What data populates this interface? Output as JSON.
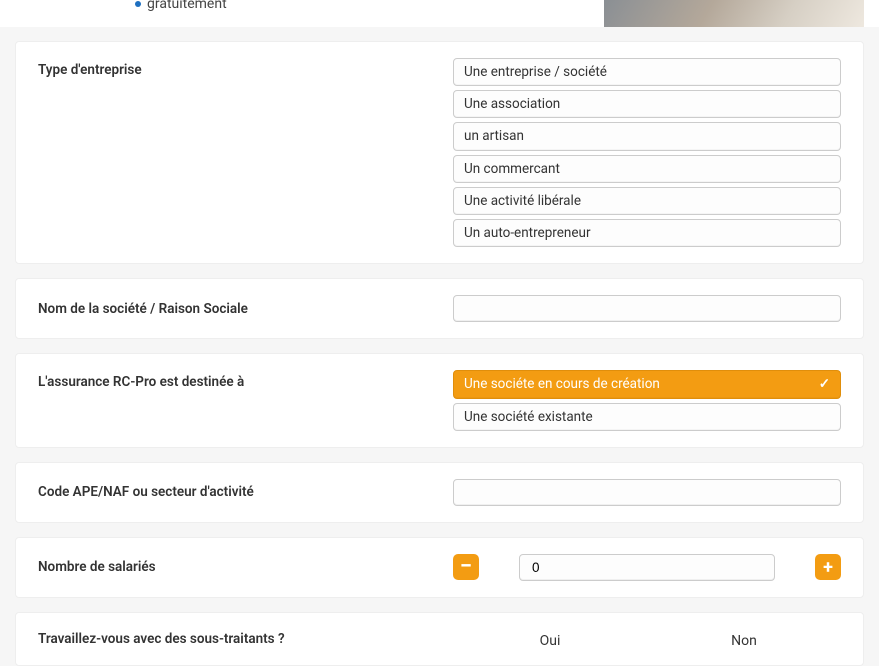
{
  "hero": {
    "bullet_text": "gratuitement"
  },
  "q_type": {
    "label": "Type d'entreprise",
    "options": [
      "Une entreprise / société",
      "Une association",
      "un artisan",
      "Un commercant",
      "Une activité libérale",
      "Un auto-entrepreneur"
    ]
  },
  "q_name": {
    "label": "Nom de la société / Raison Sociale",
    "value": ""
  },
  "q_destinee": {
    "label": "L'assurance RC-Pro est destinée à",
    "options": [
      "Une sociéte en cours de création",
      "Une société existante"
    ],
    "selected_index": 0
  },
  "q_ape": {
    "label": "Code APE/NAF ou secteur d'activité",
    "value": ""
  },
  "q_salaries": {
    "label": "Nombre de salariés",
    "value": "0"
  },
  "q_soustraitants": {
    "label": "Travaillez-vous avec des sous-traitants ?",
    "yes": "Oui",
    "no": "Non"
  }
}
